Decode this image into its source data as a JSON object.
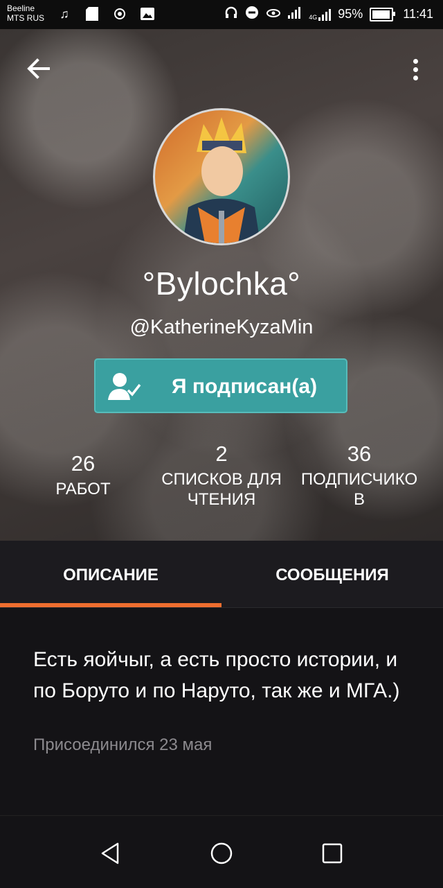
{
  "status_bar": {
    "carrier_line1": "Beeline",
    "carrier_line2": "MTS RUS",
    "network": "4G",
    "battery_percent": "95%",
    "battery_level": 0.95,
    "time": "11:41",
    "icons": [
      "music-icon",
      "sd-card-icon",
      "wifi-hotspot-icon",
      "image-icon",
      "headphones-icon",
      "do-not-disturb-icon",
      "eye-icon",
      "signal-icon",
      "signal-4g-icon",
      "battery-icon"
    ]
  },
  "header": {
    "back_icon": "arrow-left-icon",
    "more_icon": "more-vert-icon",
    "display_name": "°Bylochka°",
    "username": "@KatherineKyzaMin",
    "follow_button": {
      "label": "Я подписан(а)",
      "icon": "user-check-icon",
      "color": "#3aa0a0"
    },
    "stats": {
      "works": {
        "value": "26",
        "label": "РАБОТ"
      },
      "reading_lists": {
        "value": "2",
        "label_line1": "СПИСКОВ ДЛЯ",
        "label_line2": "ЧТЕНИЯ"
      },
      "followers": {
        "value": "36",
        "label_line1": "ПОДПИСЧИКО",
        "label_line2": "В"
      }
    }
  },
  "tabs": {
    "items": [
      {
        "label": "ОПИСАНИЕ",
        "active": true
      },
      {
        "label": "СООБЩЕНИЯ",
        "active": false
      }
    ],
    "accent_color": "#ee6e2f"
  },
  "description": {
    "text": "Есть яойчыг, а есть просто истории, и по Боруто и по Наруто, так же и МГА.)",
    "joined": "Присоединился 23 мая"
  },
  "nav_bar": {
    "buttons": [
      "back-triangle-icon",
      "home-circle-icon",
      "recents-square-icon"
    ]
  }
}
